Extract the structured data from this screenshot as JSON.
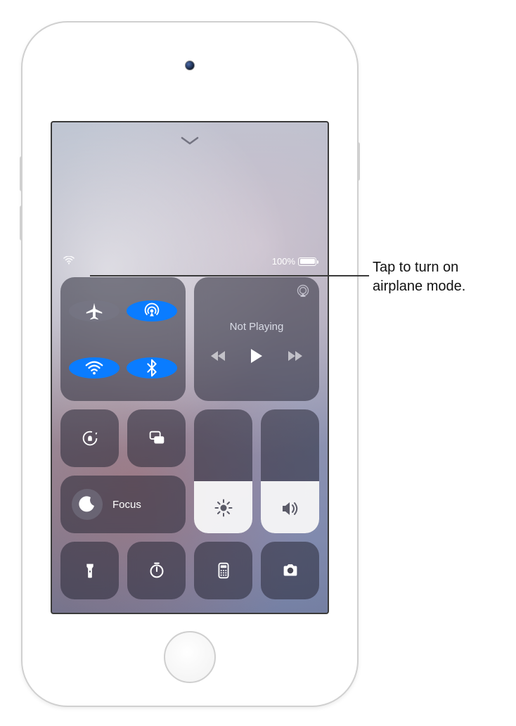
{
  "status": {
    "battery_label": "100%"
  },
  "connectivity": {
    "airplane_on": false,
    "airdrop_on": true,
    "wifi_on": true,
    "bluetooth_on": true
  },
  "media": {
    "title": "Not Playing"
  },
  "focus": {
    "label": "Focus"
  },
  "sliders": {
    "brightness_percent": 42,
    "volume_percent": 42
  },
  "callout": {
    "line1": "Tap to turn on",
    "line2": "airplane mode."
  }
}
